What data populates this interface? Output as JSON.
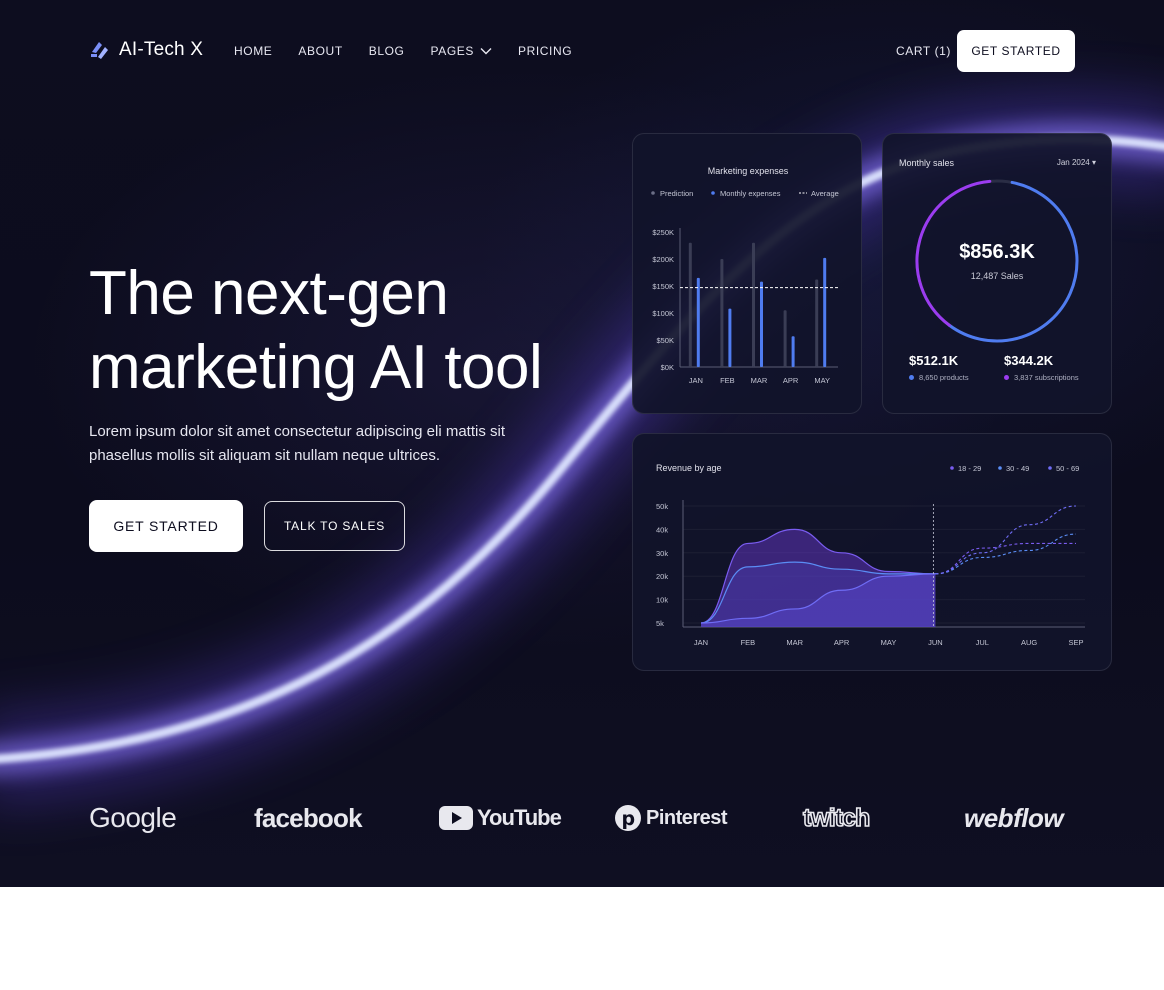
{
  "brand": {
    "name": "AI-Tech X"
  },
  "nav": {
    "items": [
      "HOME",
      "ABOUT",
      "BLOG",
      "PAGES",
      "PRICING"
    ],
    "cart_label": "CART (1)",
    "cta_label": "GET STARTED"
  },
  "hero": {
    "headline_line1": "The next-gen",
    "headline_line2": "marketing AI tool",
    "subtext": "Lorem ipsum dolor sit amet consectetur adipiscing eli mattis sit phasellus mollis sit aliquam sit nullam neque ultrices.",
    "primary_cta": "GET STARTED",
    "secondary_cta": "TALK TO SALES"
  },
  "chart_data": [
    {
      "type": "bar",
      "title": "Marketing expenses",
      "legend": [
        "Prediction",
        "Monthly expenses",
        "Average"
      ],
      "categories": [
        "JAN",
        "FEB",
        "MAR",
        "APR",
        "MAY"
      ],
      "ytick_labels": [
        "$0K",
        "$50K",
        "$100K",
        "$150K",
        "$200K",
        "$250K"
      ],
      "ylim": [
        0,
        250
      ],
      "series": [
        {
          "name": "Prediction",
          "values": [
            230,
            200,
            230,
            105,
            162
          ]
        },
        {
          "name": "Monthly expenses",
          "values": [
            165,
            108,
            158,
            57,
            202
          ]
        }
      ],
      "average": 147,
      "colors": {
        "prediction": "#3a3d55",
        "monthly": "#4f7cf0",
        "average": "#ffffff"
      }
    },
    {
      "type": "pie",
      "title": "Monthly sales",
      "period": "Jan 2024",
      "total": "$856.3K",
      "total_caption": "12,487 Sales",
      "slices": [
        {
          "label": "8,650 products",
          "amount": "$512.1K",
          "value": 512.1,
          "color": "#4f7cf0"
        },
        {
          "label": "3,837 subscriptions",
          "amount": "$344.2K",
          "value": 344.2,
          "color": "#9b3cf0"
        }
      ]
    },
    {
      "type": "area",
      "title": "Revenue by age",
      "categories": [
        "JAN",
        "FEB",
        "MAR",
        "APR",
        "MAY",
        "JUN",
        "JUL",
        "AUG",
        "SEP"
      ],
      "ytick_labels": [
        "5k",
        "10k",
        "20k",
        "30k",
        "40k",
        "50k"
      ],
      "legend": [
        "18 - 29",
        "30 - 49",
        "50 - 69"
      ],
      "series": [
        {
          "name": "18 - 29",
          "values": [
            5,
            34,
            40,
            30,
            22,
            21,
            32,
            34,
            34
          ],
          "color": "#7a5cf0"
        },
        {
          "name": "30 - 49",
          "values": [
            5,
            24,
            26,
            23,
            21,
            21,
            28,
            31,
            38
          ],
          "color": "#5a8df5"
        },
        {
          "name": "50 - 69",
          "values": [
            5,
            6,
            8,
            14,
            20,
            21,
            30,
            42,
            50
          ],
          "color": "#6f6cf5"
        }
      ],
      "forecast_from": "JUN"
    }
  ],
  "logos": [
    "Google",
    "facebook",
    "YouTube",
    "Pinterest",
    "twitch",
    "webflow"
  ]
}
